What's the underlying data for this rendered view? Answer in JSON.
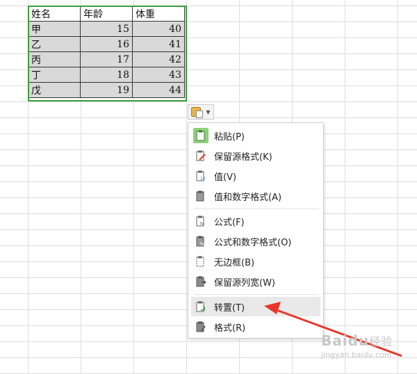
{
  "table": {
    "headers": [
      "姓名",
      "年龄",
      "体重"
    ],
    "rows": [
      [
        "甲",
        "15",
        "40"
      ],
      [
        "乙",
        "16",
        "41"
      ],
      [
        "丙",
        "17",
        "42"
      ],
      [
        "丁",
        "18",
        "43"
      ],
      [
        "戊",
        "19",
        "44"
      ]
    ]
  },
  "paste_menu": {
    "items": [
      {
        "label": "粘贴(P)",
        "icon": "paste-icon"
      },
      {
        "label": "保留源格式(K)",
        "icon": "keep-source-format-icon"
      },
      {
        "label": "值(V)",
        "icon": "paste-values-icon"
      },
      {
        "label": "值和数字格式(A)",
        "icon": "values-number-format-icon"
      },
      {
        "label": "公式(F)",
        "icon": "formula-icon"
      },
      {
        "label": "公式和数字格式(O)",
        "icon": "formula-number-format-icon"
      },
      {
        "label": "无边框(B)",
        "icon": "no-borders-icon"
      },
      {
        "label": "保留源列宽(W)",
        "icon": "keep-column-width-icon"
      },
      {
        "label": "转置(T)",
        "icon": "transpose-icon"
      },
      {
        "label": "格式(R)",
        "icon": "paste-format-icon"
      }
    ],
    "highlighted": "转置(T)"
  },
  "watermark": {
    "brand": "Baidu",
    "brand_suffix": "经验",
    "url": "jingyan.baidu.com"
  },
  "colors": {
    "selection_border": "#3c9e3c",
    "cell_fill": "#d9d9d9",
    "arrow": "#e8352a",
    "menu_highlight": "#e9e9e9"
  }
}
